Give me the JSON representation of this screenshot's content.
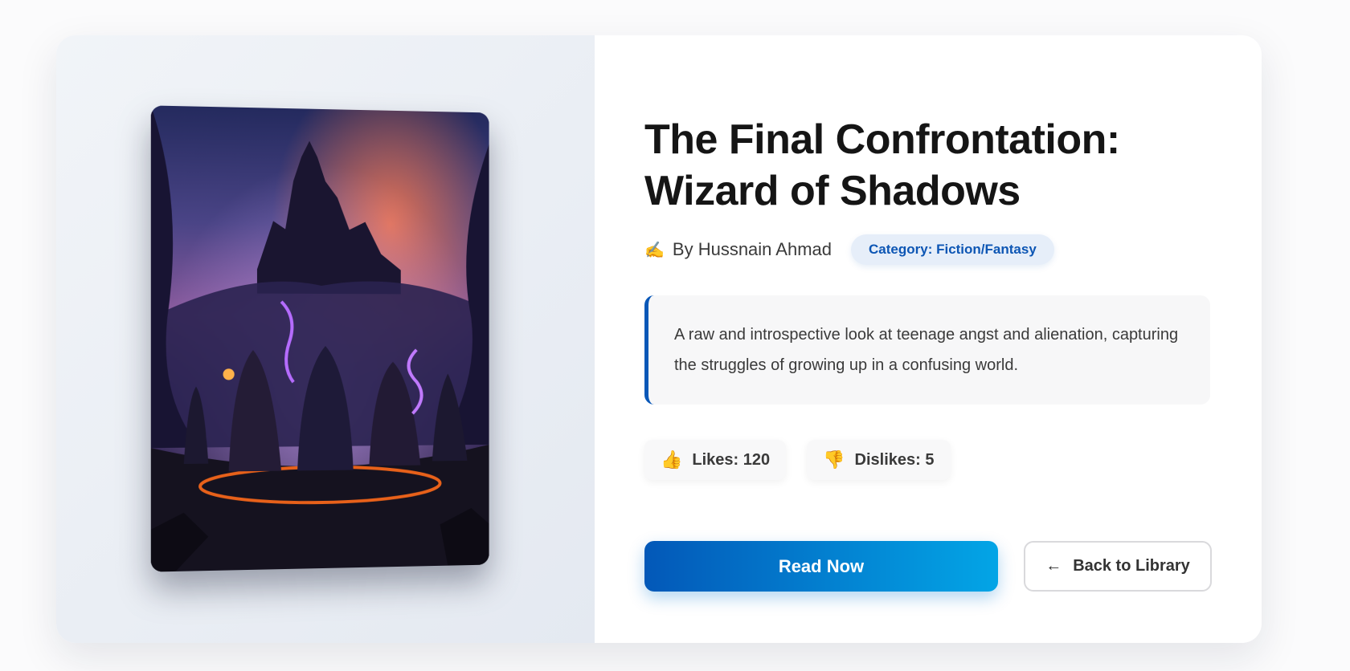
{
  "book": {
    "title": "The Final Confrontation: Wizard of Shadows",
    "author": "By Hussnain Ahmad",
    "category": "Category: Fiction/Fantasy",
    "description": "A raw and introspective look at teenage angst and alienation, capturing the struggles of growing up in a confusing world."
  },
  "reactions": {
    "likes_label": "Likes: 120",
    "dislikes_label": "Dislikes: 5"
  },
  "actions": {
    "read_label": "Read Now",
    "back_label": "Back to Library"
  },
  "icons": {
    "author": "writing-hand-icon",
    "like": "thumbs-up-icon",
    "dislike": "thumbs-down-icon",
    "back": "left-arrow-icon"
  },
  "colors": {
    "accent": "#0a58b8",
    "accent_light": "#03a5e6",
    "badge_bg": "#e6eef9",
    "title": "#151515"
  }
}
